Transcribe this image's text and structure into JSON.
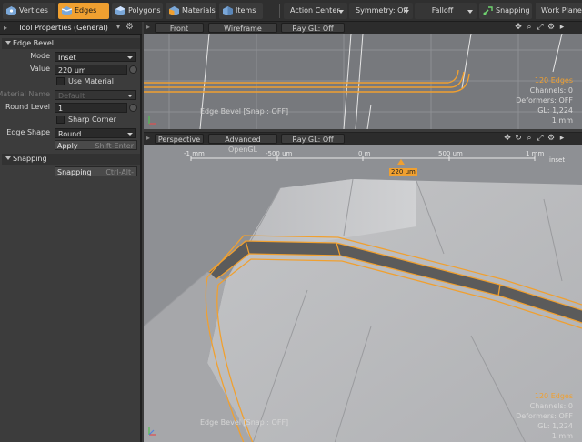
{
  "toolbar": {
    "vertices": "Vertices",
    "edges": "Edges",
    "polygons": "Polygons",
    "materials": "Materials",
    "items": "Items",
    "action_center": "Action Center",
    "symmetry": "Symmetry: Off",
    "falloff": "Falloff",
    "snapping": "Snapping",
    "work_plane": "Work Plane"
  },
  "panel": {
    "title": "Tool Properties (General)",
    "section_title": "Edge Bevel",
    "mode_label": "Mode",
    "mode_value": "Inset",
    "value_label": "Value",
    "value_value": "220 um",
    "use_material_label": "Use Material",
    "material_name_label": "Material Name",
    "material_name_value": "Default",
    "round_level_label": "Round Level",
    "round_level_value": "1",
    "sharp_corner_label": "Sharp Corner",
    "edge_shape_label": "Edge Shape",
    "edge_shape_value": "Round",
    "apply_label": "Apply",
    "apply_hotkey": "Shift-Enter",
    "snapping_section": "Snapping",
    "snapping_button": "Snapping",
    "snapping_hotkey": "Ctrl-Alt-"
  },
  "viewport_top": {
    "view": "Front",
    "shading": "Wireframe",
    "raygl": "Ray GL: Off",
    "snap_msg": "Edge Bevel  [Snap : OFF]",
    "stats": {
      "edges": "120 Edges",
      "channels": "Channels: 0",
      "deformers": "Deformers: OFF",
      "gl": "GL: 1,224",
      "scale": "1 mm"
    }
  },
  "viewport_bottom": {
    "view": "Perspective",
    "shading": "Advanced OpenGL",
    "raygl": "Ray GL: Off",
    "ruler": {
      "ticks": [
        "-1 mm",
        "-500 um",
        "0 m",
        "500 um",
        "1 mm"
      ],
      "unit": "inset",
      "marker": "220 um"
    },
    "snap_msg": "Edge Bevel  [Snap : OFF]",
    "stats": {
      "edges": "120 Edges",
      "channels": "Channels: 0",
      "deformers": "Deformers: OFF",
      "gl": "GL: 1,224",
      "scale": "1 mm"
    }
  },
  "colors": {
    "accent": "#f0a030",
    "selection_edge": "#f0a030",
    "panel_bg": "#3c3c3c"
  }
}
